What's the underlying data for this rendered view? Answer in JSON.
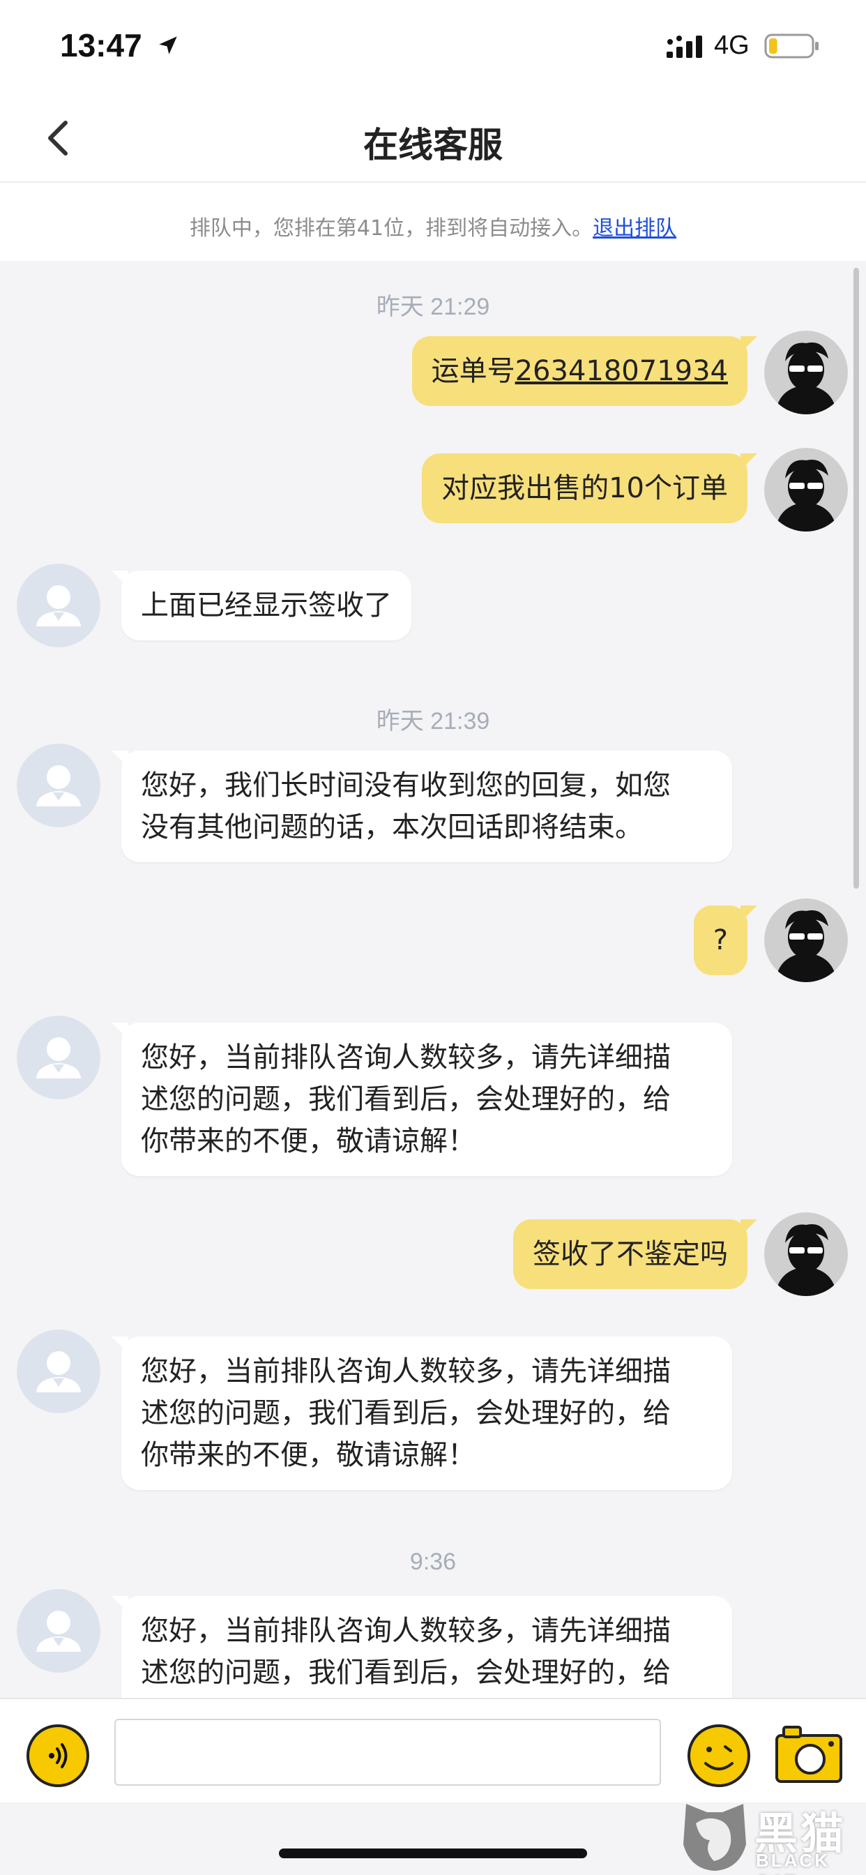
{
  "status_bar": {
    "time": "13:47",
    "network": "4G",
    "battery_level": 0.2,
    "icons": [
      "location-arrow-icon",
      "signal-icon",
      "battery-icon"
    ]
  },
  "nav": {
    "title": "在线客服",
    "back_icon": "chevron-left-icon"
  },
  "queue_notice": {
    "text": "排队中，您排在第41位，排到将自动接入。",
    "exit_link": "退出排队"
  },
  "timestamps": [
    "昨天 21:29",
    "昨天 21:39",
    "9:36"
  ],
  "messages": [
    {
      "from": "me",
      "prefix": "运单号",
      "link": "263418071934"
    },
    {
      "from": "me",
      "text": "对应我出售的10个订单"
    },
    {
      "from": "agent",
      "text": "上面已经显示签收了"
    },
    {
      "from": "agent",
      "text": "您好，我们长时间没有收到您的回复，如您\n没有其他问题的话，本次回话即将结束。"
    },
    {
      "from": "me",
      "text": "?"
    },
    {
      "from": "agent",
      "text": "您好，当前排队咨询人数较多，请先详细描\n述您的问题，我们看到后，会处理好的，给\n你带来的不便，敬请谅解！"
    },
    {
      "from": "me",
      "text": "签收了不鉴定吗"
    },
    {
      "from": "agent",
      "text": "您好，当前排队咨询人数较多，请先详细描\n述您的问题，我们看到后，会处理好的，给\n你带来的不便，敬请谅解！"
    },
    {
      "from": "agent",
      "text": "您好，当前排队咨询人数较多，请先详细描\n述您的问题，我们看到后，会处理好的，给\n你带来的不便，敬请谅解！"
    }
  ],
  "input_bar": {
    "placeholder": "",
    "icons": [
      "voice-icon",
      "emoji-icon",
      "camera-icon"
    ]
  },
  "watermark": {
    "brand": "黑猫",
    "brand_en": "BLACK CAT"
  },
  "colors": {
    "my_bubble": "#f7df7c",
    "agent_bubble": "#ffffff",
    "background": "#f4f4f6",
    "accent": "#f6c900",
    "link": "#1f4fd8"
  }
}
